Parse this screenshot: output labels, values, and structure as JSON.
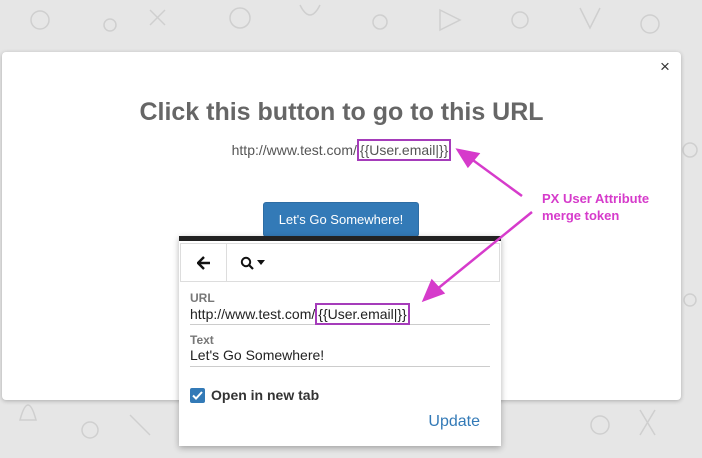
{
  "modal": {
    "title": "Click this button to go to this URL",
    "url_prefix": "http://www.test.com/",
    "url_token": "{{User.email|}}",
    "button_label": "Let's Go Somewhere!",
    "close_symbol": "×"
  },
  "popup": {
    "toolbar": {
      "back_icon": "arrow-left-icon",
      "search_icon": "search-icon",
      "dropdown_icon": "caret-down-icon"
    },
    "url_label": "URL",
    "url_prefix": "http://www.test.com/",
    "url_token": "{{User.email|}}",
    "text_label": "Text",
    "text_value": "Let's Go Somewhere!",
    "checkbox_label": "Open in new tab",
    "checkbox_checked": true,
    "update_label": "Update"
  },
  "annotation": {
    "line1": "PX User Attribute",
    "line2": "merge token",
    "color": "#d63bcb"
  },
  "colors": {
    "primary": "#337ab7",
    "token_border": "#a53cba"
  }
}
